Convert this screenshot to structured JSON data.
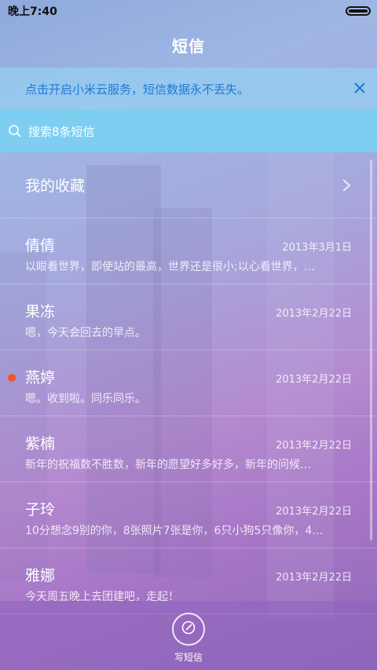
{
  "status_bar": {
    "time": "晚上7:40",
    "icon": "battery-icon"
  },
  "header": {
    "title": "短信"
  },
  "banner": {
    "text": "点击开启小米云服务，短信数据永不丢失。",
    "close_icon": "close-icon"
  },
  "search": {
    "placeholder": "搜索8条短信",
    "icon": "search-icon"
  },
  "favorites": {
    "label": "我的收藏",
    "icon": "chevron-right-icon"
  },
  "messages": [
    {
      "name": "倩倩",
      "date": "2013年3月1日",
      "preview": "以眼看世界，即使站的最高，世界还是很小;以心看世界，…",
      "unread": false
    },
    {
      "name": "果冻",
      "date": "2013年2月22日",
      "preview": "嗯，今天会回去的早点。",
      "unread": false
    },
    {
      "name": "燕婷",
      "date": "2013年2月22日",
      "preview": "嗯。收到啦。同乐同乐。",
      "unread": true
    },
    {
      "name": "紫楠",
      "date": "2013年2月22日",
      "preview": "新年的祝福数不胜数，新年的愿望好多好多，新年的问候…",
      "unread": false
    },
    {
      "name": "子玲",
      "date": "2013年2月22日",
      "preview": "10分想念9别的你，8张照片7张是你，6只小狗5只像你，4…",
      "unread": false
    },
    {
      "name": "雅娜",
      "date": "2013年2月22日",
      "preview": "今天周五晚上去团建吧，走起！",
      "unread": false
    }
  ],
  "compose": {
    "label": "写短信",
    "icon": "compose-icon"
  },
  "colors": {
    "accent_blue": "#1b7bd6",
    "unread_dot": "#f0552a"
  }
}
